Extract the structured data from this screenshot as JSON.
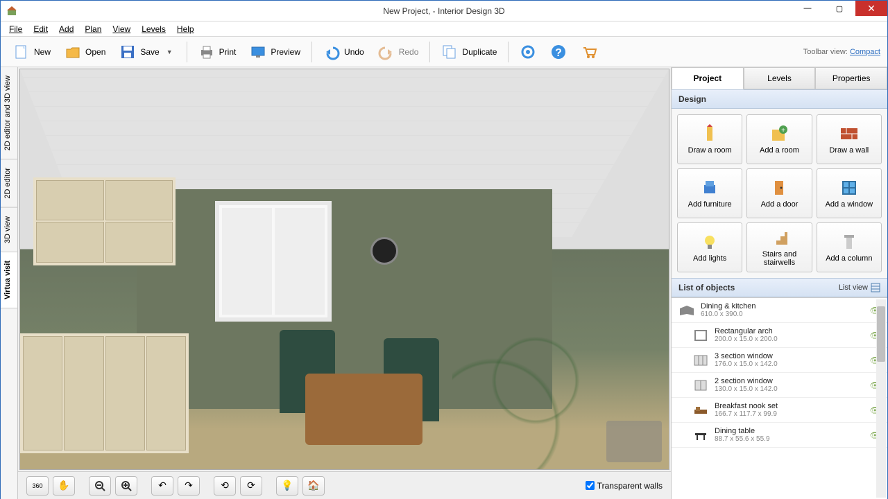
{
  "window": {
    "title": "New Project, - Interior Design 3D"
  },
  "menu": [
    "File",
    "Edit",
    "Add",
    "Plan",
    "View",
    "Levels",
    "Help"
  ],
  "toolbar": {
    "new": "New",
    "open": "Open",
    "save": "Save",
    "print": "Print",
    "preview": "Preview",
    "undo": "Undo",
    "redo": "Redo",
    "duplicate": "Duplicate",
    "right_label": "Toolbar view:",
    "right_link": "Compact"
  },
  "vtabs": [
    "2D editor and 3D view",
    "2D editor",
    "3D view",
    "Virtua visit"
  ],
  "vtab_active": 3,
  "view_controls": {
    "transparent_walls": "Transparent walls",
    "checked": true
  },
  "sidebar": {
    "tabs": [
      "Project",
      "Levels",
      "Properties"
    ],
    "active_tab": 0,
    "design_header": "Design",
    "design_buttons": [
      "Draw a room",
      "Add a room",
      "Draw a wall",
      "Add furniture",
      "Add a door",
      "Add a window",
      "Add lights",
      "Stairs and stairwells",
      "Add a column"
    ],
    "list_header": "List of objects",
    "list_view_label": "List view",
    "objects": [
      {
        "name": "Dining & kitchen",
        "dims": "610.0 x 390.0",
        "level": 0
      },
      {
        "name": "Rectangular arch",
        "dims": "200.0 x 15.0 x 200.0",
        "level": 1
      },
      {
        "name": "3 section window",
        "dims": "176.0 x 15.0 x 142.0",
        "level": 1
      },
      {
        "name": "2 section window",
        "dims": "130.0 x 15.0 x 142.0",
        "level": 1
      },
      {
        "name": "Breakfast nook set",
        "dims": "166.7 x 117.7 x 99.9",
        "level": 1
      },
      {
        "name": "Dining table",
        "dims": "88.7 x 55.6 x 55.9",
        "level": 1
      }
    ]
  }
}
